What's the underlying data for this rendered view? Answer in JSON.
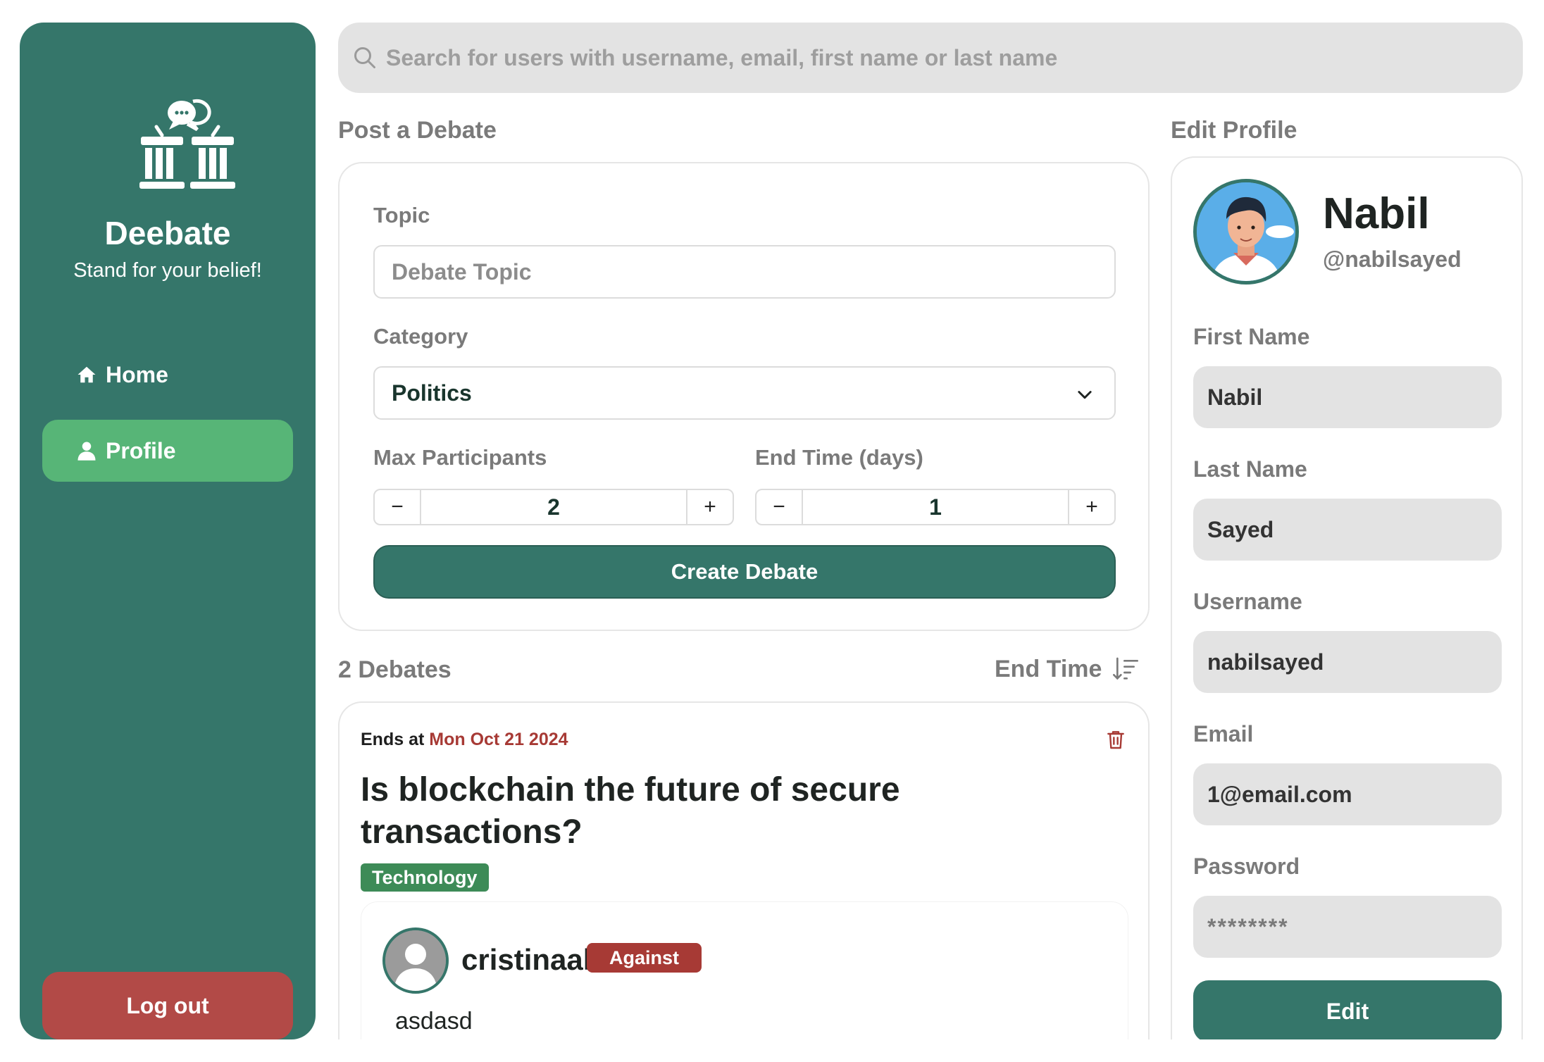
{
  "search": {
    "placeholder": "Search for users with username, email, first name or last name"
  },
  "sidebar": {
    "brand": "Deebate",
    "tagline": "Stand for your belief!",
    "items": [
      {
        "label": "Home",
        "icon": "home-icon"
      },
      {
        "label": "Profile",
        "icon": "user-icon",
        "active": true
      }
    ],
    "logout_label": "Log out"
  },
  "post": {
    "title": "Post a Debate",
    "topic_label": "Topic",
    "topic_placeholder": "Debate Topic",
    "category_label": "Category",
    "category_value": "Politics",
    "max_label": "Max Participants",
    "max_value": "2",
    "end_label": "End Time (days)",
    "end_value": "1",
    "minus": "−",
    "plus": "+",
    "create_label": "Create Debate"
  },
  "debates": {
    "count_label": "2 Debates",
    "sort_label": "End Time",
    "items": [
      {
        "ends_prefix": "Ends at",
        "ends_date": "Mon Oct 21 2024",
        "title": "Is blockchain the future of secure transactions?",
        "tag": "Technology",
        "comment": {
          "user": "cristinaal",
          "stance": "Against",
          "text": "asdasd"
        }
      }
    ]
  },
  "profile": {
    "title": "Edit Profile",
    "name": "Nabil",
    "handle": "@nabilsayed",
    "first_label": "First Name",
    "first_value": "Nabil",
    "last_label": "Last Name",
    "last_value": "Sayed",
    "username_label": "Username",
    "username_value": "nabilsayed",
    "email_label": "Email",
    "email_value": "1@email.com",
    "password_label": "Password",
    "password_value": "********",
    "edit_label": "Edit"
  },
  "colors": {
    "primary": "#35766a",
    "active": "#57b577",
    "danger": "#b24a47",
    "tag": "#3d8b57"
  }
}
